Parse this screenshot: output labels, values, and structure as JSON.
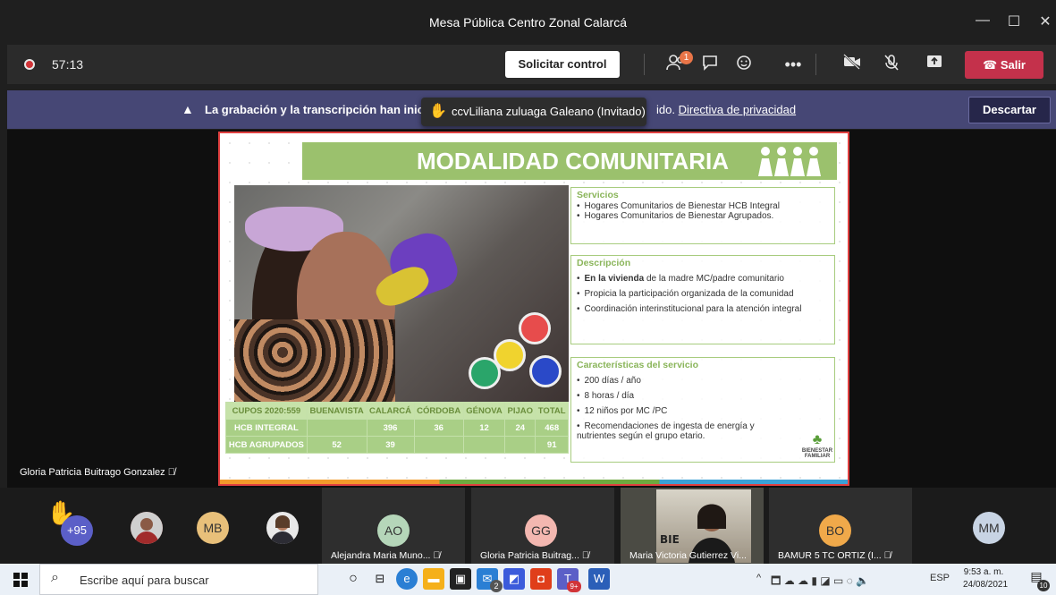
{
  "window": {
    "title": "Mesa Pública Centro Zonal Calarcá",
    "minimize": "—",
    "maximize": "☐",
    "close": "✕"
  },
  "toolbar": {
    "timer": "57:13",
    "request_control": "Solicitar control",
    "participants_badge": "1",
    "leave": "Salir"
  },
  "notification": {
    "message_visible": "La grabación y la transcripción han inicia",
    "message_tail": "ido.",
    "privacy_link": "Directiva de privacidad",
    "dismiss": "Descartar"
  },
  "tooltip": {
    "text": "ccvLiliana zuluaga Galeano (Invitado)"
  },
  "presenter_name": "Gloria Patricia Buitrago Gonzalez",
  "slide": {
    "title": "MODALIDAD COMUNITARIA",
    "servicios": {
      "heading": "Servicios",
      "items": [
        "Hogares Comunitarios de Bienestar HCB Integral",
        "Hogares Comunitarios de Bienestar Agrupados."
      ]
    },
    "descripcion": {
      "heading": "Descripción",
      "items": [
        {
          "bold": "En la vivienda",
          "rest": " de la madre MC/padre comunitario"
        },
        {
          "bold": "",
          "rest": "Propicia la participación organizada de la comunidad"
        },
        {
          "bold": "",
          "rest": "Coordinación interinstitucional para la atención integral"
        }
      ]
    },
    "caracteristicas": {
      "heading": "Características del servicio",
      "items": [
        "200 días / año",
        "8 horas / día",
        "12  niños por MC /PC",
        "Recomendaciones de ingesta de energía y nutrientes según el grupo etario."
      ]
    },
    "logo": "BIENESTAR FAMILIAR",
    "table": {
      "headers": [
        "CUPOS 2020:559",
        "BUENAVISTA",
        "CALARCÁ",
        "CÓRDOBA",
        "GÉNOVA",
        "PIJAO",
        "TOTAL"
      ],
      "rows": [
        [
          "HCB INTEGRAL",
          "",
          "396",
          "36",
          "12",
          "24",
          "468"
        ],
        [
          "HCB AGRUPADOS",
          "52",
          "39",
          "",
          "",
          "",
          "91"
        ]
      ]
    }
  },
  "participants": {
    "overflow": "+95",
    "tiles": [
      {
        "initials": "MB",
        "color": "#e8c07a"
      },
      {
        "initials": "AO",
        "name": "Alejandra Maria Muno...",
        "color": "#b5d6b9"
      },
      {
        "initials": "GG",
        "name": "Gloria Patricia Buitrag...",
        "color": "#f3b7b0"
      },
      {
        "initials": "",
        "name": "Maria Victoria Gutierrez Vi..."
      },
      {
        "initials": "BO",
        "name": "BAMUR 5 TC ORTIZ (I...",
        "color": "#f0a94a"
      },
      {
        "initials": "MM",
        "color": "#c8d4e4"
      }
    ]
  },
  "taskbar": {
    "search_placeholder": "Escribe aquí para buscar",
    "lang": "ESP",
    "time": "9:53 a. m.",
    "date": "24/08/2021",
    "mail_badge": "2",
    "teams_badge": "9+",
    "notif_count": "10"
  }
}
